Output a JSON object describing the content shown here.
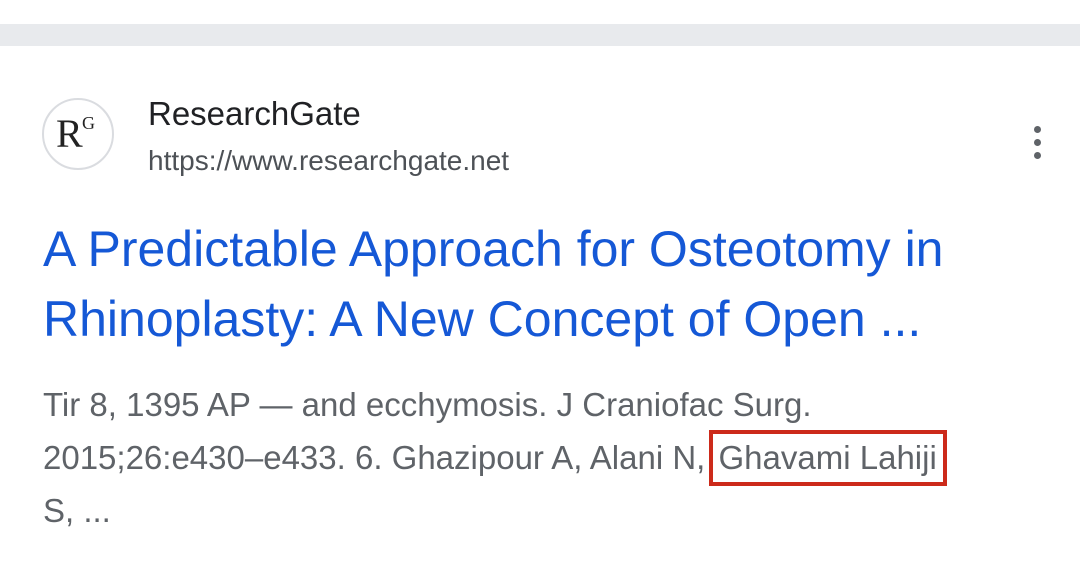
{
  "result": {
    "site_name": "ResearchGate",
    "site_url": "https://www.researchgate.net",
    "favicon_letters": {
      "main": "R",
      "super": "G"
    },
    "title_line1": "A Predictable Approach for Osteotomy in",
    "title_line2": "Rhinoplasty: A New Concept of Open ...",
    "snippet_line1": "Tir 8, 1395 AP — and ecchymosis. J Craniofac Surg.",
    "snippet_line2_prefix": "2015;26:e430–e433. 6. Ghazipour A, Alani N, ",
    "snippet_highlight": "Ghavami Lahiji",
    "snippet_line3": "S, ...",
    "icons": {
      "more": "more-vertical-icon",
      "favicon": "researchgate-logo-icon"
    }
  },
  "colors": {
    "title": "#1558d6",
    "highlight_box": "#cc2a1a",
    "divider": "#e8eaed"
  }
}
